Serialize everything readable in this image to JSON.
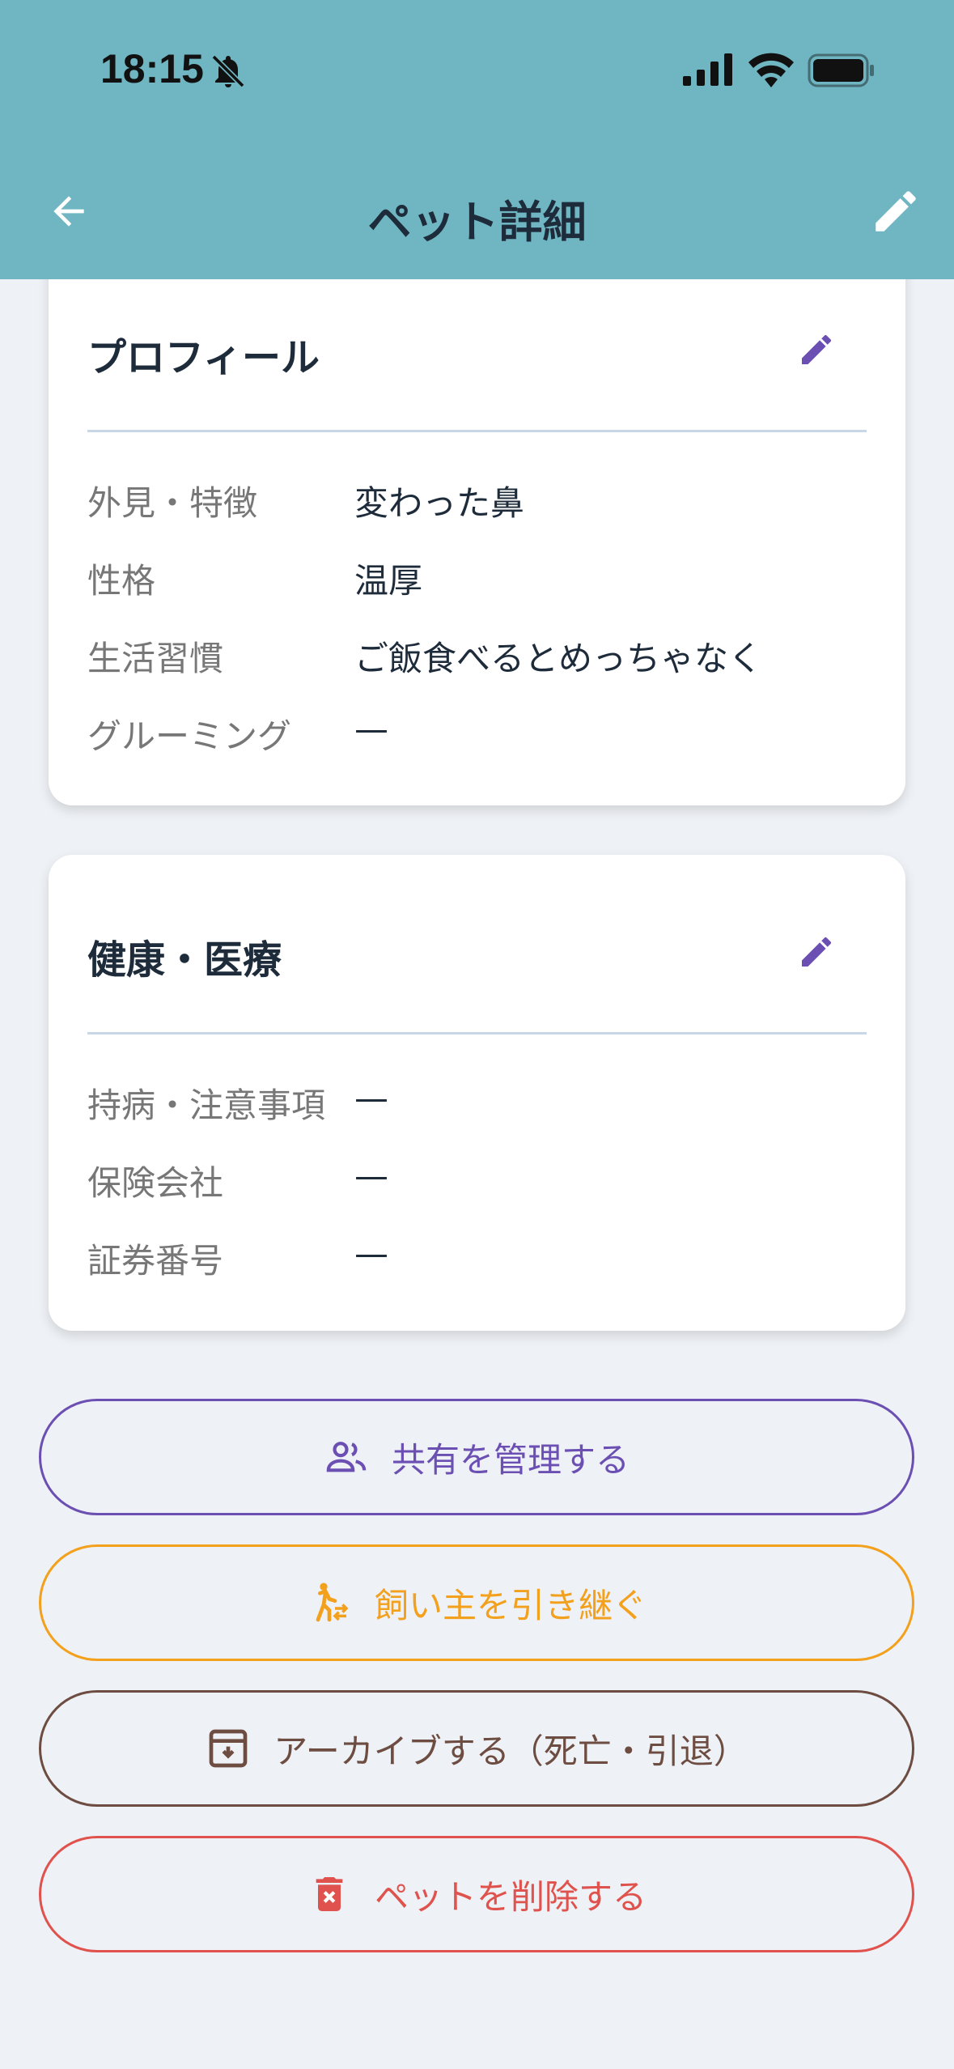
{
  "status_bar": {
    "time": "18:15"
  },
  "header": {
    "title": "ペット詳細"
  },
  "profile": {
    "title": "プロフィール",
    "rows": [
      {
        "label": "外見・特徴",
        "value": "変わった鼻"
      },
      {
        "label": "性格",
        "value": "温厚"
      },
      {
        "label": "生活習慣",
        "value": "ご飯食べるとめっちゃなく"
      },
      {
        "label": "グルーミング",
        "value": "—"
      }
    ]
  },
  "health": {
    "title": "健康・医療",
    "rows": [
      {
        "label": "持病・注意事項",
        "value": "—"
      },
      {
        "label": "保険会社",
        "value": "—"
      },
      {
        "label": "証券番号",
        "value": "—"
      }
    ]
  },
  "actions": {
    "share_label": "共有を管理する",
    "transfer_label": "飼い主を引き継ぐ",
    "archive_label": "アーカイブする（死亡・引退）",
    "delete_label": "ペットを削除する"
  },
  "colors": {
    "header_bg": "#6fb6c2",
    "accent_purple": "#6b4fb3",
    "accent_orange": "#f3a01d",
    "accent_brown": "#6d4c41",
    "accent_red": "#e0524d"
  },
  "icons": {
    "back": "arrow-left-icon",
    "edit": "pencil-icon",
    "share": "people-icon",
    "transfer": "person-walking-icon",
    "archive": "archive-box-icon",
    "delete": "trash-icon"
  }
}
